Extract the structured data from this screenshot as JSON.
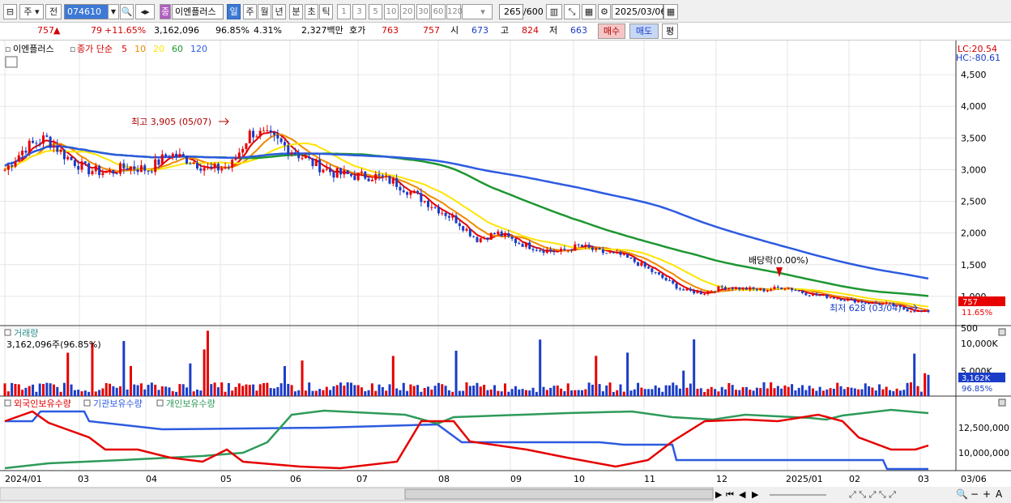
{
  "toolbar": {
    "period_main": "주",
    "period_prev": "전",
    "code": "074610",
    "fav_badge": "종",
    "stock_name": "이엔플러스",
    "periods": [
      "일",
      "주",
      "월",
      "년",
      "분",
      "초",
      "틱"
    ],
    "intervals": [
      "1",
      "3",
      "5",
      "10",
      "20",
      "30",
      "60",
      "120"
    ],
    "count": "265",
    "count_max": "/600",
    "date": "2025/03/06"
  },
  "quote": {
    "price": "757",
    "arrow": "▲",
    "change": "79",
    "change_pct": "+11.65%",
    "volume": "3,162,096",
    "vol_ratio": "96.85%",
    "turnover": "4.31%",
    "amount": "2,327백만",
    "ask_label": "호가",
    "ask1": "763",
    "ask2": "757",
    "open_label": "시",
    "open": "673",
    "high_label": "고",
    "high": "824",
    "low_label": "저",
    "low": "663",
    "buy": "매수",
    "sell": "매도",
    "avg": "평"
  },
  "price_pane": {
    "legend": {
      "name": "이엔플러스",
      "ma_title": "종가 단순",
      "ma": [
        "5",
        "10",
        "20",
        "60",
        "120"
      ],
      "ma_colors": [
        "#e60000",
        "#f08a00",
        "#ffe400",
        "#1e9632",
        "#2d5be0"
      ]
    },
    "y_ticks": [
      "4,500",
      "4,000",
      "3,500",
      "3,000",
      "2,500",
      "2,000",
      "1,500",
      "1,000",
      "500"
    ],
    "lc": "LC:20.54",
    "hc": "HC:-80.61",
    "high_label": "최고 3,905 (05/07)",
    "low_label": "최저 628 (03/04)",
    "div_label": "배당락(0.00%)",
    "last_price": "757",
    "last_pct": "11.65%"
  },
  "volume_pane": {
    "title": "거래량",
    "value": "3,162,096주(96.85%)",
    "y_ticks": [
      "10,000K",
      "5,000K"
    ],
    "last": "3,162K",
    "last_pct": "96.85%"
  },
  "holders_pane": {
    "labels": [
      "외국인보유수량",
      "기관보유수량",
      "개인보유수량"
    ],
    "colors": [
      "#e60000",
      "#2d5be0",
      "#2e9a5a"
    ],
    "y_ticks": [
      "12,500,000",
      "10,000,000"
    ]
  },
  "x_axis": {
    "labels": [
      "2024/01",
      "03",
      "04",
      "05",
      "06",
      "07",
      "08",
      "09",
      "10",
      "11",
      "12",
      "2025/01",
      "02",
      "03",
      "03/06"
    ]
  },
  "chart_data": {
    "type": "candlestick",
    "price_axis": {
      "ylim": [
        500,
        5000
      ],
      "ticks": [
        4500,
        4000,
        3500,
        3000,
        2500,
        2000,
        1500,
        1000,
        500
      ]
    },
    "markers": {
      "high": {
        "value": 3905,
        "date": "05/07"
      },
      "low": {
        "value": 628,
        "date": "03/04"
      }
    },
    "last": {
      "price": 757,
      "change_pct": 11.65,
      "volume": 3162096
    },
    "months": [
      "2024/01",
      "03",
      "04",
      "05",
      "06",
      "07",
      "08",
      "09",
      "10",
      "11",
      "12",
      "2025/01",
      "02",
      "03"
    ],
    "close_approx": [
      3000,
      3350,
      3500,
      3200,
      3000,
      2950,
      3050,
      3000,
      3250,
      3150,
      3000,
      3050,
      3600,
      3500,
      3300,
      3100,
      2950,
      2900,
      2900,
      2800,
      2600,
      2400,
      2200,
      1900,
      2000,
      1850,
      1750,
      1700,
      1800,
      1700,
      1650,
      1500,
      1300,
      1100,
      1050,
      1150,
      1120,
      1100,
      1150,
      1050,
      1000,
      950,
      900,
      880,
      780,
      757
    ]
  }
}
